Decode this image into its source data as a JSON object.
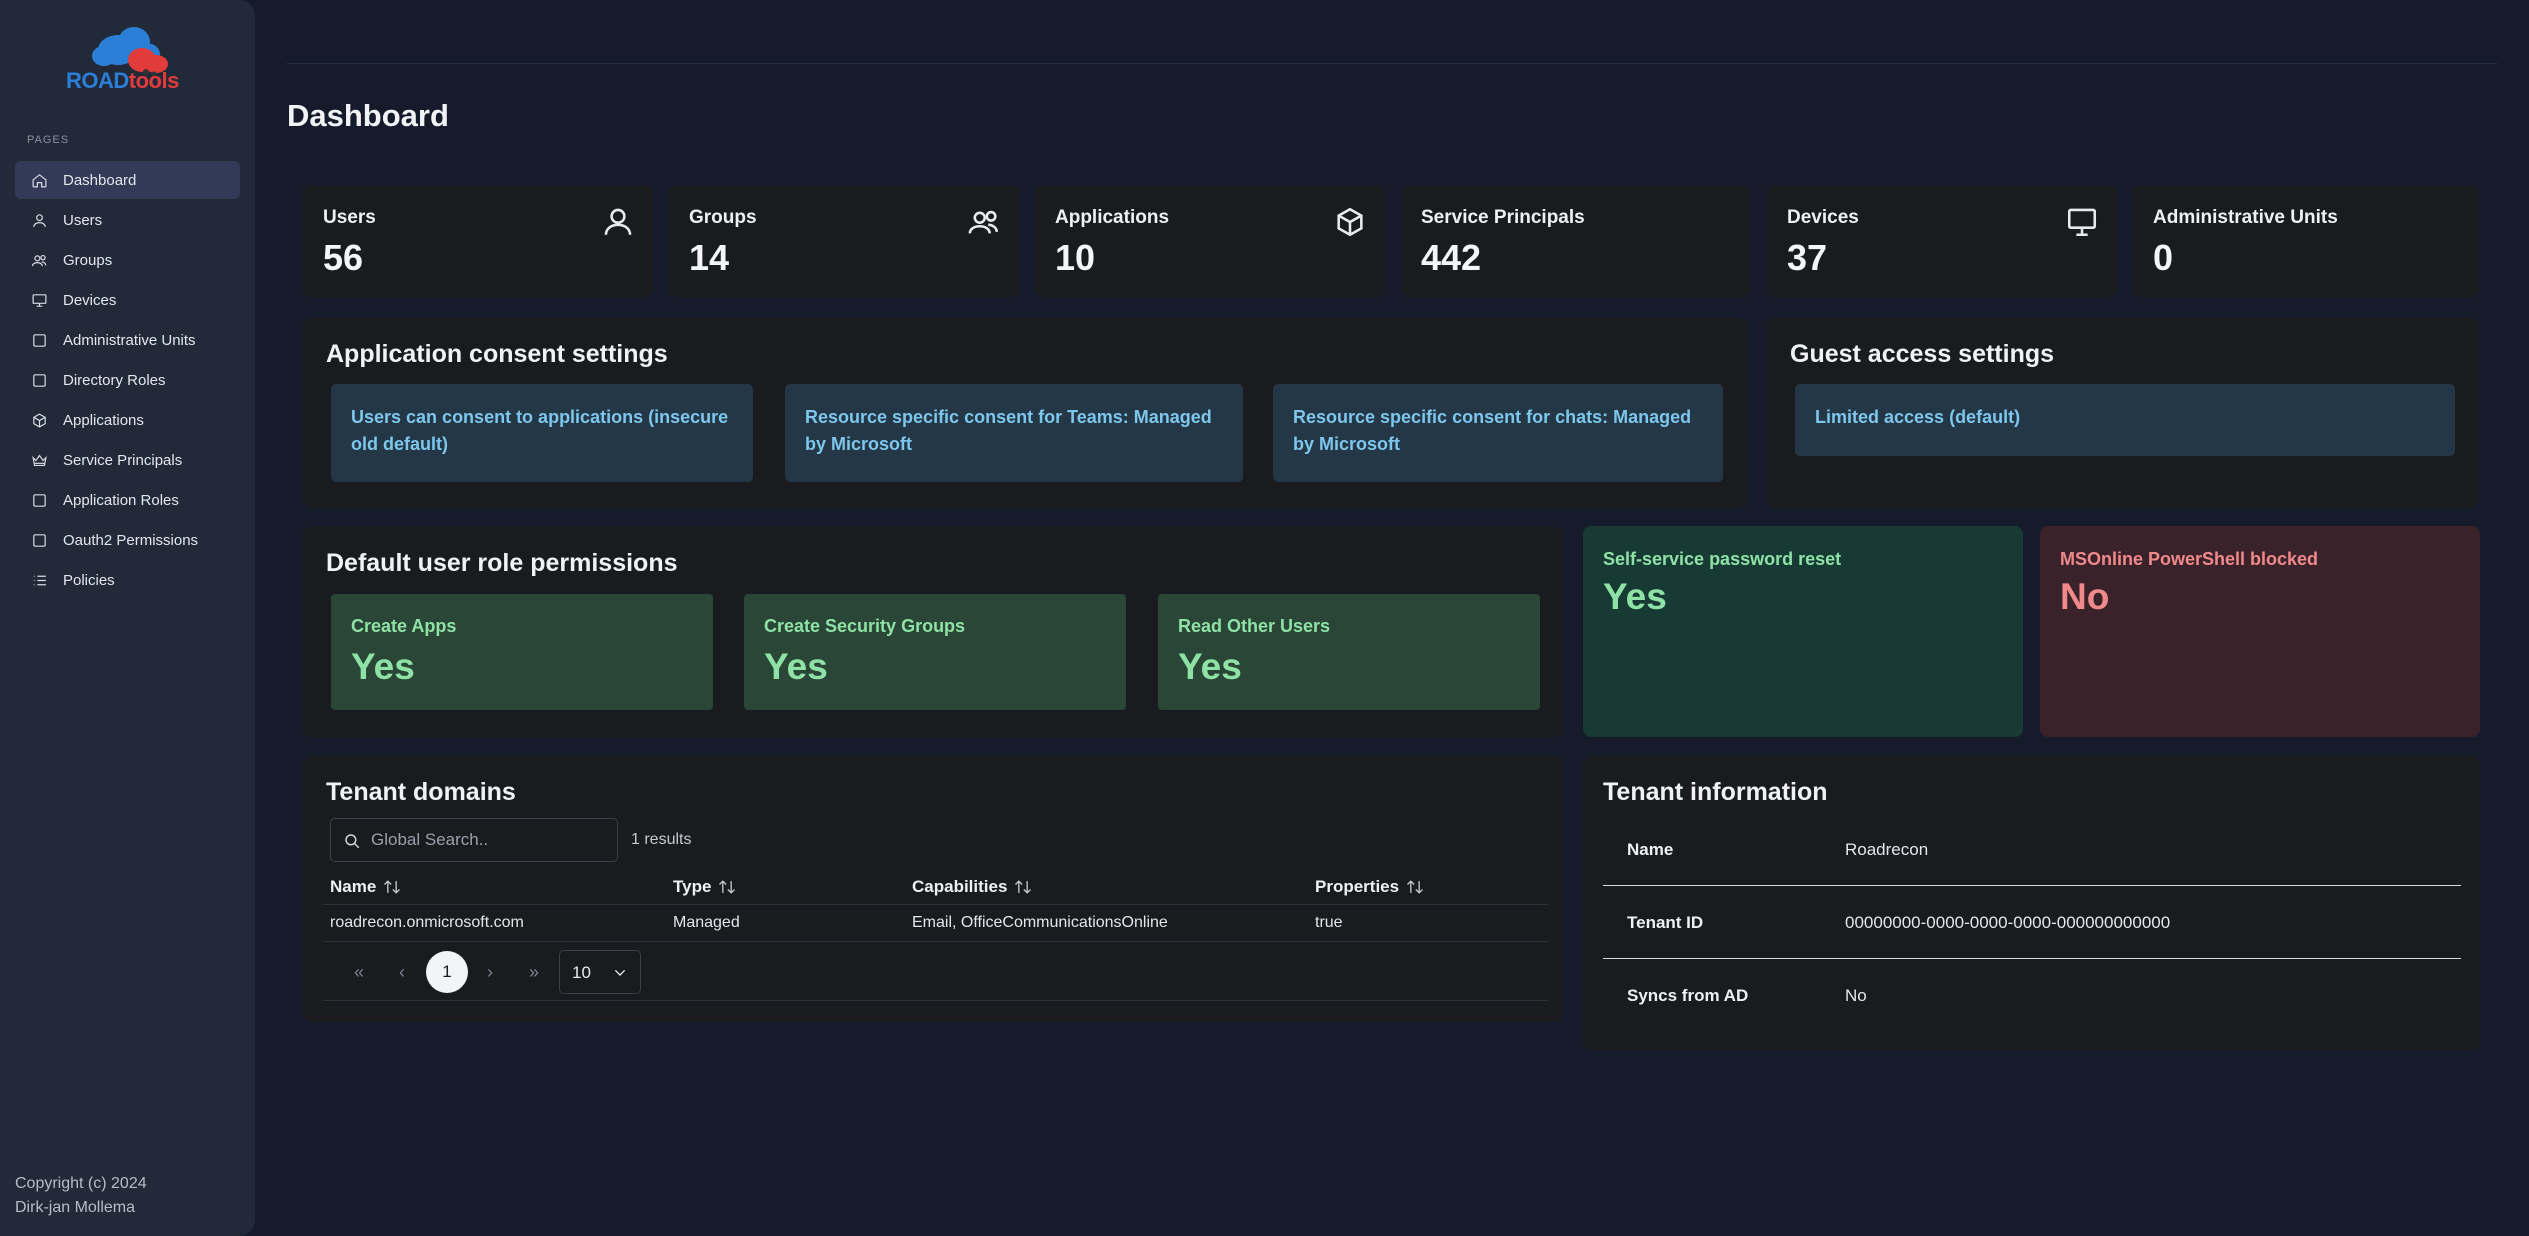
{
  "sidebar": {
    "logo": {
      "part1": "ROAD",
      "part2": "tools"
    },
    "section_label": "PAGES",
    "items": [
      {
        "label": "Dashboard",
        "icon": "home-icon"
      },
      {
        "label": "Users",
        "icon": "user-icon"
      },
      {
        "label": "Groups",
        "icon": "users-icon"
      },
      {
        "label": "Devices",
        "icon": "monitor-icon"
      },
      {
        "label": "Administrative Units",
        "icon": "square-icon"
      },
      {
        "label": "Directory Roles",
        "icon": "square-icon"
      },
      {
        "label": "Applications",
        "icon": "box-icon"
      },
      {
        "label": "Service Principals",
        "icon": "crown-icon"
      },
      {
        "label": "Application Roles",
        "icon": "square-icon"
      },
      {
        "label": "Oauth2 Permissions",
        "icon": "square-icon"
      },
      {
        "label": "Policies",
        "icon": "list-icon"
      }
    ],
    "active": "Dashboard",
    "copyright_line1": "Copyright (c) 2024",
    "copyright_line2": "Dirk-jan Mollema"
  },
  "page_title": "Dashboard",
  "stats": [
    {
      "label": "Users",
      "value": "56",
      "icon": "user-icon"
    },
    {
      "label": "Groups",
      "value": "14",
      "icon": "users-icon"
    },
    {
      "label": "Applications",
      "value": "10",
      "icon": "box-icon"
    },
    {
      "label": "Service Principals",
      "value": "442",
      "icon": ""
    },
    {
      "label": "Devices",
      "value": "37",
      "icon": "monitor-icon"
    },
    {
      "label": "Administrative Units",
      "value": "0",
      "icon": ""
    }
  ],
  "consent": {
    "title": "Application consent settings",
    "items": [
      "Users can consent to applications (insecure old default)",
      "Resource specific consent for Teams: Managed by Microsoft",
      "Resource specific consent for chats: Managed by Microsoft"
    ]
  },
  "guest": {
    "title": "Guest access settings",
    "item": "Limited access (default)"
  },
  "default_perms": {
    "title": "Default user role permissions",
    "items": [
      {
        "label": "Create Apps",
        "value": "Yes"
      },
      {
        "label": "Create Security Groups",
        "value": "Yes"
      },
      {
        "label": "Read Other Users",
        "value": "Yes"
      }
    ]
  },
  "sspr": {
    "label": "Self-service password reset",
    "value": "Yes"
  },
  "msonline": {
    "label": "MSOnline PowerShell blocked",
    "value": "No"
  },
  "domains": {
    "title": "Tenant domains",
    "search_placeholder": "Global Search..",
    "results": "1 results",
    "columns": [
      "Name",
      "Type",
      "Capabilities",
      "Properties"
    ],
    "rows": [
      [
        "roadrecon.onmicrosoft.com",
        "Managed",
        "Email, OfficeCommunicationsOnline",
        "true"
      ]
    ],
    "page": "1",
    "page_size": "10"
  },
  "tenant": {
    "title": "Tenant information",
    "rows": [
      {
        "label": "Name",
        "value": "Roadrecon"
      },
      {
        "label": "Tenant ID",
        "value": "00000000-0000-0000-0000-000000000000"
      },
      {
        "label": "Syncs from AD",
        "value": "No"
      }
    ]
  },
  "colors": {
    "background": "#151b2b",
    "sidebar": "#222938",
    "card": "#1a1b1f",
    "consent_box": "#243746",
    "consent_text": "#7dc6ec",
    "perm_box": "#2a4636",
    "perm_text": "#8ee2a6",
    "sspr_bg": "#173a34",
    "msonline_bg": "#3a222b",
    "msonline_text": "#f08a8a"
  }
}
